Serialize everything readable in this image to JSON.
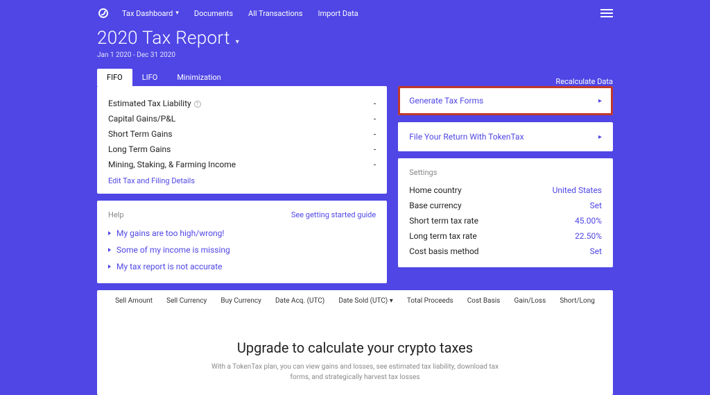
{
  "nav": {
    "items": [
      "Tax Dashboard",
      "Documents",
      "All Transactions",
      "Import Data"
    ]
  },
  "page": {
    "title": "2020 Tax Report",
    "date_range": "Jan 1 2020 - Dec 31 2020"
  },
  "tabs": {
    "fifo": "FIFO",
    "lifo": "LIFO",
    "min": "Minimization"
  },
  "recalc": "Recalculate Data",
  "stats": {
    "etl": {
      "label": "Estimated Tax Liability",
      "value": "-"
    },
    "cg": {
      "label": "Capital Gains/P&L",
      "value": "-"
    },
    "stg": {
      "label": "Short Term Gains",
      "value": "-"
    },
    "ltg": {
      "label": "Long Term Gains",
      "value": "-"
    },
    "msf": {
      "label": "Mining, Staking, & Farming Income",
      "value": "-"
    },
    "edit": "Edit Tax and Filing Details"
  },
  "help": {
    "title": "Help",
    "guide": "See getting started guide",
    "items": [
      "My gains are too high/wrong!",
      "Some of my income is missing",
      "My tax report is not accurate"
    ]
  },
  "actions": {
    "generate": "Generate Tax Forms",
    "file": "File Your Return With TokenTax"
  },
  "settings": {
    "title": "Settings",
    "home_label": "Home country",
    "home_value": "United States",
    "base_label": "Base currency",
    "base_value": "Set",
    "st_label": "Short term tax rate",
    "st_value": "45.00%",
    "lt_label": "Long term tax rate",
    "lt_value": "22.50%",
    "cb_label": "Cost basis method",
    "cb_value": "Set"
  },
  "table_headers": [
    "Sell Amount",
    "Sell Currency",
    "Buy Currency",
    "Date Acq. (UTC)",
    "Date Sold (UTC) ▾",
    "Total Proceeds",
    "Cost Basis",
    "Gain/Loss",
    "Short/Long"
  ],
  "upgrade": {
    "title": "Upgrade to calculate your crypto taxes",
    "sub": "With a TokenTax plan, you can view gains and losses, see estimated tax liability, download tax forms, and strategically harvest tax losses"
  }
}
